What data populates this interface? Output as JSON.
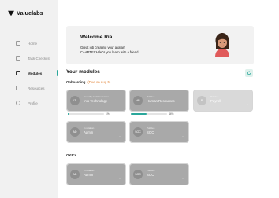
{
  "app": {
    "name": "Valuelabs"
  },
  "sidebar": {
    "items": [
      {
        "label": "Home",
        "icon": "home-icon",
        "active": false
      },
      {
        "label": "Task Checklist",
        "icon": "calendar-icon",
        "active": false
      },
      {
        "label": "Modules",
        "icon": "book-icon",
        "active": true
      },
      {
        "label": "Resources",
        "icon": "folder-icon",
        "active": false
      },
      {
        "label": "Profile",
        "icon": "user-icon",
        "active": false
      }
    ]
  },
  "welcome": {
    "title": "Welcome Ria!",
    "line1": "Great job creating your avatar!",
    "line2": "CAAPTECH let's you learn with a friend"
  },
  "modules": {
    "title": "Your modules",
    "onboarding": {
      "label": "Onboarding",
      "note": "(Due on Aug 5)",
      "cards": [
        {
          "abbr": "IT",
          "category": "Security and Resources",
          "name": "Info Technology",
          "progress_percent": 1,
          "progress_label": "1%"
        },
        {
          "abbr": "HR",
          "category": "Policies",
          "name": "Human Resources",
          "progress_percent": 44,
          "progress_label": "44%"
        },
        {
          "abbr": "P",
          "category": "Policies",
          "name": "Payroll"
        },
        {
          "abbr": "AD",
          "category": "In rotation",
          "name": "Admin"
        },
        {
          "abbr": "SOC",
          "category": "Policies",
          "name": "SOC"
        }
      ]
    },
    "okrs": {
      "label": "OKR's",
      "cards": [
        {
          "abbr": "AD",
          "category": "In rotation",
          "name": "Admin"
        },
        {
          "abbr": "SOC",
          "category": "Policies",
          "name": "SOC"
        }
      ]
    }
  },
  "colors": {
    "accent": "#2aa79b",
    "due": "#e07d2c",
    "card": "#a9a9a9"
  }
}
